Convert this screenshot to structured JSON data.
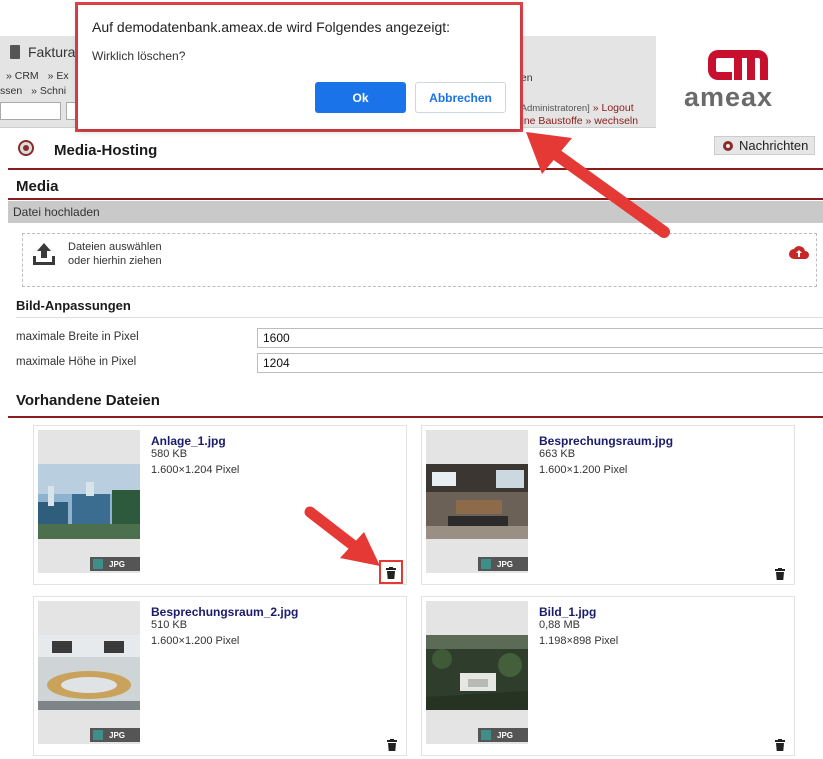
{
  "header": {
    "app_title": "Faktura",
    "nav_row1": [
      "» CRM",
      "» Ex"
    ],
    "nav_row2": [
      "ssen",
      "» Schni"
    ],
    "nav_right": "ten",
    "user_role": "[Administratoren]",
    "logout": "» Logout",
    "company": "gne Baustoffe",
    "switch": "» wechseln",
    "logo_text": "ameax"
  },
  "page": {
    "title": "Media-Hosting",
    "messages_button": "Nachrichten"
  },
  "media": {
    "heading": "Media",
    "upload_bar": "Datei hochladen",
    "dropzone_line1": "Dateien auswählen",
    "dropzone_line2": "oder hierhin ziehen"
  },
  "adjustments": {
    "heading": "Bild-Anpassungen",
    "max_width_label": "maximale Breite in Pixel",
    "max_width_value": "1600",
    "max_height_label": "maximale Höhe in Pixel",
    "max_height_value": "1204"
  },
  "files": {
    "heading": "Vorhandene Dateien",
    "items": [
      {
        "name": "Anlage_1.jpg",
        "size": "580 KB",
        "dims": "1.600×1.204 Pixel",
        "type": "JPG"
      },
      {
        "name": "Besprechungsraum.jpg",
        "size": "663 KB",
        "dims": "1.600×1.200 Pixel",
        "type": "JPG"
      },
      {
        "name": "Besprechungsraum_2.jpg",
        "size": "510 KB",
        "dims": "1.600×1.200 Pixel",
        "type": "JPG"
      },
      {
        "name": "Bild_1.jpg",
        "size": "0,88 MB",
        "dims": "1.198×898 Pixel",
        "type": "JPG"
      }
    ]
  },
  "dialog": {
    "title": "Auf demodatenbank.ameax.de wird Folgendes angezeigt:",
    "message": "Wirklich löschen?",
    "ok_label": "Ok",
    "cancel_label": "Abbrechen"
  },
  "colors": {
    "accent": "#8b1c1c",
    "primary_button": "#1a73e8",
    "annotation": "#e53935"
  }
}
